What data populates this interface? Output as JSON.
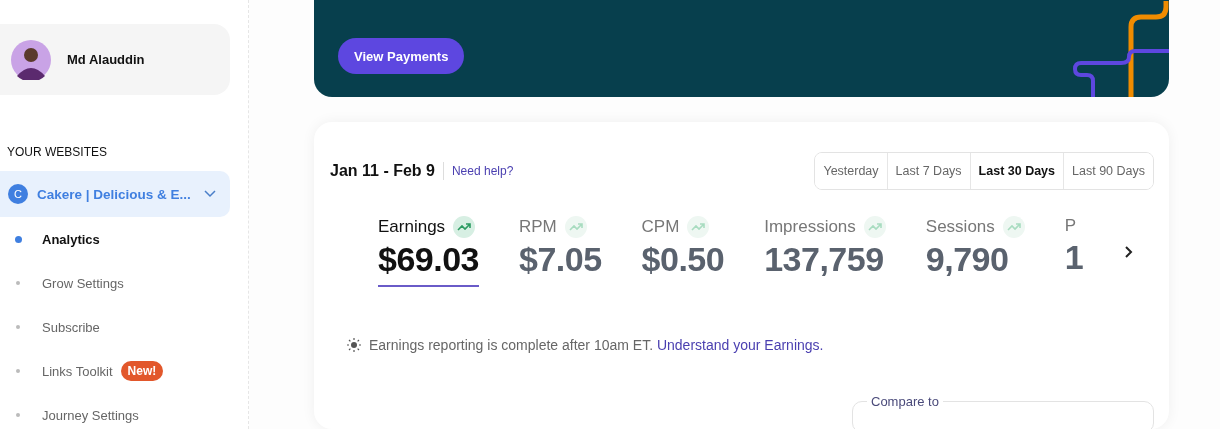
{
  "sidebar": {
    "profile": {
      "name": "Md Alauddin"
    },
    "section_title": "YOUR WEBSITES",
    "site": {
      "initial": "C",
      "name": "Cakere | Delicious & E...",
      "expanded": true
    },
    "nav_items": [
      {
        "label": "Analytics",
        "selected": true
      },
      {
        "label": "Grow Settings",
        "selected": false
      },
      {
        "label": "Subscribe",
        "selected": false
      },
      {
        "label": "Links Toolkit",
        "selected": false,
        "badge": "New!"
      },
      {
        "label": "Journey Settings",
        "selected": false
      }
    ]
  },
  "banner": {
    "button": "View Payments"
  },
  "card": {
    "date_range": "Jan 11 - Feb 9",
    "help_link": "Need help?",
    "ranges": [
      {
        "label": "Yesterday",
        "selected": false
      },
      {
        "label": "Last 7 Days",
        "selected": false
      },
      {
        "label": "Last 30 Days",
        "selected": true
      },
      {
        "label": "Last 90 Days",
        "selected": false
      }
    ],
    "metrics": [
      {
        "label": "Earnings",
        "value": "$69.03",
        "selected": true,
        "trend": true
      },
      {
        "label": "RPM",
        "value": "$7.05",
        "selected": false,
        "trend": true
      },
      {
        "label": "CPM",
        "value": "$0.50",
        "selected": false,
        "trend": true
      },
      {
        "label": "Impressions",
        "value": "137,759",
        "selected": false,
        "trend": true
      },
      {
        "label": "Sessions",
        "value": "9,790",
        "selected": false,
        "trend": true
      },
      {
        "label": "P",
        "value": "1",
        "selected": false,
        "trend": false
      }
    ],
    "note": {
      "text": "Earnings reporting is complete after 10am ET.",
      "link": "Understand your Earnings."
    },
    "compare_label": "Compare to"
  }
}
